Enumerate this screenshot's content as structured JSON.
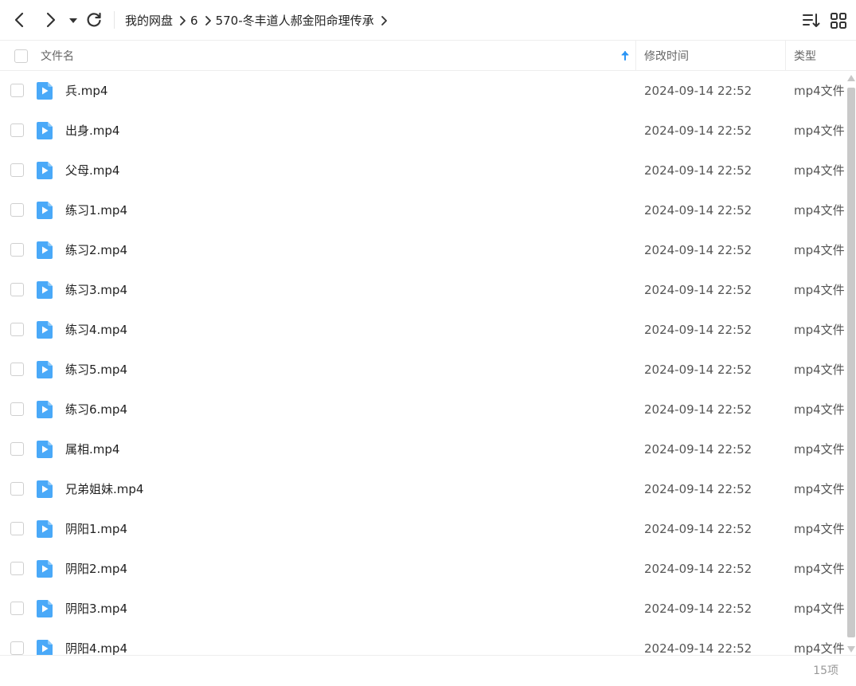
{
  "toolbar": {
    "breadcrumb": [
      "我的网盘",
      "6",
      "570-冬丰道人郝金阳命理传承"
    ]
  },
  "header": {
    "name_label": "文件名",
    "date_label": "修改时间",
    "type_label": "类型"
  },
  "colors": {
    "accent": "#2b95f5",
    "file_icon": "#4aa9f8"
  },
  "files": [
    {
      "name": "兵.mp4",
      "date": "2024-09-14 22:52",
      "type": "mp4文件"
    },
    {
      "name": "出身.mp4",
      "date": "2024-09-14 22:52",
      "type": "mp4文件"
    },
    {
      "name": "父母.mp4",
      "date": "2024-09-14 22:52",
      "type": "mp4文件"
    },
    {
      "name": "练习1.mp4",
      "date": "2024-09-14 22:52",
      "type": "mp4文件"
    },
    {
      "name": "练习2.mp4",
      "date": "2024-09-14 22:52",
      "type": "mp4文件"
    },
    {
      "name": "练习3.mp4",
      "date": "2024-09-14 22:52",
      "type": "mp4文件"
    },
    {
      "name": "练习4.mp4",
      "date": "2024-09-14 22:52",
      "type": "mp4文件"
    },
    {
      "name": "练习5.mp4",
      "date": "2024-09-14 22:52",
      "type": "mp4文件"
    },
    {
      "name": "练习6.mp4",
      "date": "2024-09-14 22:52",
      "type": "mp4文件"
    },
    {
      "name": "属相.mp4",
      "date": "2024-09-14 22:52",
      "type": "mp4文件"
    },
    {
      "name": "兄弟姐妹.mp4",
      "date": "2024-09-14 22:52",
      "type": "mp4文件"
    },
    {
      "name": "阴阳1.mp4",
      "date": "2024-09-14 22:52",
      "type": "mp4文件"
    },
    {
      "name": "阴阳2.mp4",
      "date": "2024-09-14 22:52",
      "type": "mp4文件"
    },
    {
      "name": "阴阳3.mp4",
      "date": "2024-09-14 22:52",
      "type": "mp4文件"
    },
    {
      "name": "阴阳4.mp4",
      "date": "2024-09-14 22:52",
      "type": "mp4文件"
    }
  ],
  "footer": {
    "count": "15项"
  }
}
